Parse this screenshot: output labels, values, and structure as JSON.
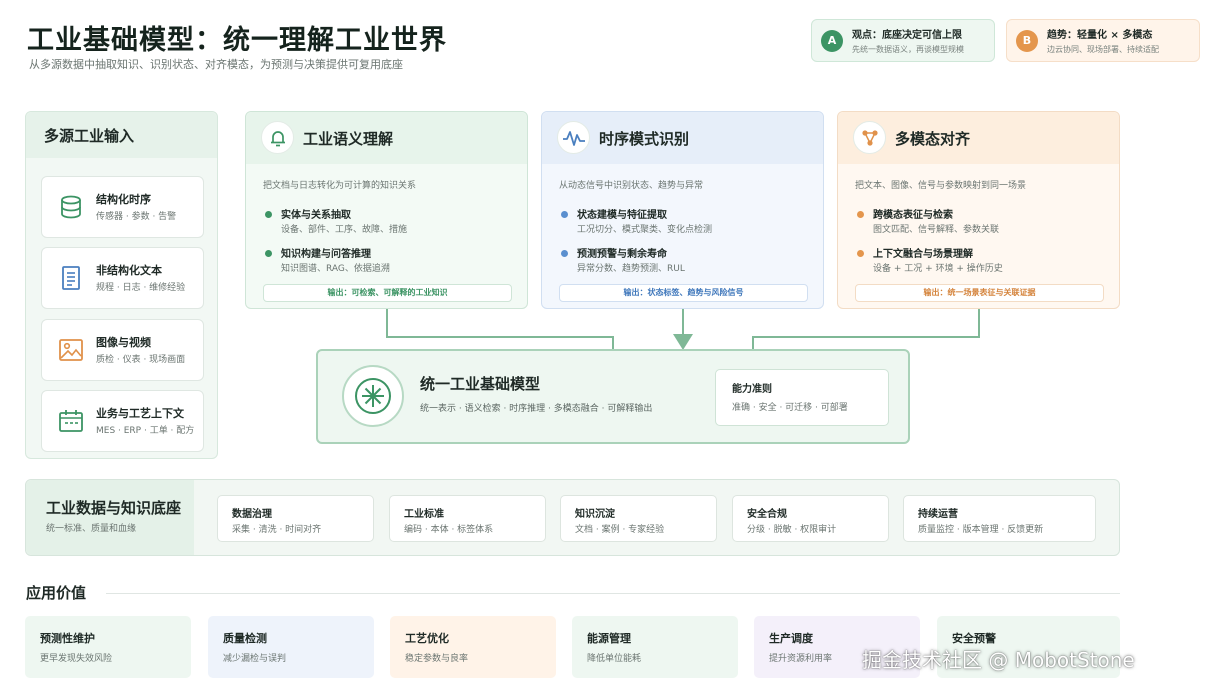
{
  "header": {
    "title": "工业基础模型：统一理解工业世界",
    "subtitle": "从多源数据中抽取知识、识别状态、对齐模态，为预测与决策提供可复用底座"
  },
  "badges": [
    {
      "letter": "A",
      "main": "观点：底座决定可信上限",
      "sub": "先统一数据语义，再谈模型规模",
      "color": "#3c9464"
    },
    {
      "letter": "B",
      "main": "趋势：轻量化 × 多模态",
      "sub": "边云协同、现场部署、持续适配",
      "color": "#e4964d"
    }
  ],
  "inputs": {
    "title": "多源工业输入",
    "items": [
      {
        "name": "结构化时序",
        "desc": "传感器 · 参数 · 告警",
        "icon": "database-icon"
      },
      {
        "name": "非结构化文本",
        "desc": "规程 · 日志 · 维修经验",
        "icon": "document-icon"
      },
      {
        "name": "图像与视频",
        "desc": "质检 · 仪表 · 现场画面",
        "icon": "image-icon"
      },
      {
        "name": "业务与工艺上下文",
        "desc": "MES · ERP · 工单 · 配方",
        "icon": "calendar-icon"
      }
    ]
  },
  "modules": [
    {
      "title": "工业语义理解",
      "icon": "bell-icon",
      "desc": "把文档与日志转化为可计算的知识关系",
      "items": [
        {
          "title": "实体与关系抽取",
          "sub": "设备、部件、工序、故障、措施"
        },
        {
          "title": "知识构建与问答推理",
          "sub": "知识图谱、RAG、依据追溯"
        }
      ],
      "output": "输出：可检索、可解释的工业知识"
    },
    {
      "title": "时序模式识别",
      "icon": "waveform-icon",
      "desc": "从动态信号中识别状态、趋势与异常",
      "items": [
        {
          "title": "状态建模与特征提取",
          "sub": "工况切分、模式聚类、变化点检测"
        },
        {
          "title": "预测预警与剩余寿命",
          "sub": "异常分数、趋势预测、RUL"
        }
      ],
      "output": "输出：状态标签、趋势与风险信号"
    },
    {
      "title": "多模态对齐",
      "icon": "nodes-icon",
      "desc": "把文本、图像、信号与参数映射到同一场景",
      "items": [
        {
          "title": "跨模态表征与检索",
          "sub": "图文匹配、信号解释、参数关联"
        },
        {
          "title": "上下文融合与场景理解",
          "sub": "设备 + 工况 + 环境 + 操作历史"
        }
      ],
      "output": "输出：统一场景表征与关联证据"
    }
  ],
  "core": {
    "title": "统一工业基础模型",
    "sub": "统一表示 · 语义检索 · 时序推理 · 多模态融合 · 可解释输出",
    "box_title": "能力准则",
    "box_sub": "准确 · 安全 · 可迁移 · 可部署"
  },
  "foundation": {
    "title": "工业数据与知识底座",
    "sub": "统一标准、质量和血缘",
    "items": [
      {
        "title": "数据治理",
        "sub": "采集 · 清洗 · 时间对齐"
      },
      {
        "title": "工业标准",
        "sub": "编码 · 本体 · 标签体系"
      },
      {
        "title": "知识沉淀",
        "sub": "文档 · 案例 · 专家经验"
      },
      {
        "title": "安全合规",
        "sub": "分级 · 脱敏 · 权限审计"
      },
      {
        "title": "持续运营",
        "sub": "质量监控 · 版本管理 · 反馈更新"
      }
    ]
  },
  "values": {
    "title": "应用价值",
    "items": [
      {
        "title": "预测性维护",
        "sub": "更早发现失效风险",
        "color": "#eef7f1"
      },
      {
        "title": "质量检测",
        "sub": "减少漏检与误判",
        "color": "#eef3fb"
      },
      {
        "title": "工艺优化",
        "sub": "稳定参数与良率",
        "color": "#fff3e8"
      },
      {
        "title": "能源管理",
        "sub": "降低单位能耗",
        "color": "#eef7f1"
      },
      {
        "title": "生产调度",
        "sub": "提升资源利用率",
        "color": "#f4f0fa"
      },
      {
        "title": "安全预警",
        "sub": "",
        "color": "#eef7f1"
      }
    ]
  },
  "watermark": "掘金技术社区 @ MobotStone"
}
